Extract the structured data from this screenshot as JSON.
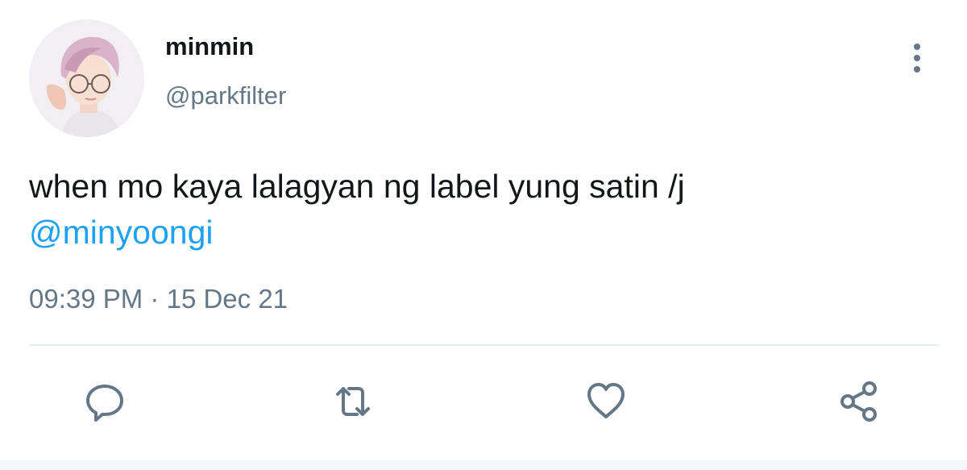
{
  "tweet": {
    "display_name": "minmin",
    "handle": "@parkfilter",
    "text": "when mo kaya lalagyan ng label yung satin /j",
    "mention": "@minyoongi",
    "time": "09:39 PM",
    "separator": "·",
    "date": "15 Dec 21"
  },
  "actions": [
    {
      "name": "reply",
      "icon": "reply-icon"
    },
    {
      "name": "retweet",
      "icon": "retweet-icon"
    },
    {
      "name": "like",
      "icon": "heart-icon"
    },
    {
      "name": "share",
      "icon": "share-icon"
    }
  ],
  "colors": {
    "text": "#14171a",
    "secondary": "#657786",
    "link": "#1da1f2",
    "divider": "#e6ecf0"
  }
}
